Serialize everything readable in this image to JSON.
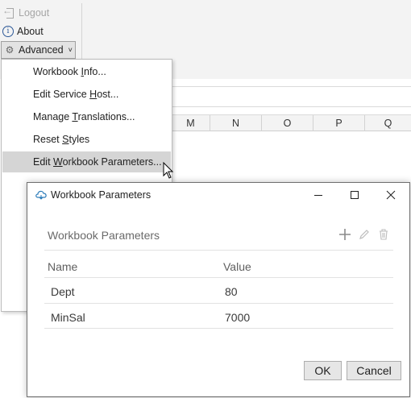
{
  "ribbon": {
    "logout_label": "Logout",
    "about_label": "About",
    "advanced_label": "Advanced",
    "advanced_chevron": "˅"
  },
  "sheet": {
    "columns": [
      "M",
      "N",
      "O",
      "P",
      "Q"
    ]
  },
  "menu": {
    "items": [
      {
        "pre": "Workbook ",
        "u": "I",
        "post": "nfo..."
      },
      {
        "pre": "Edit Service ",
        "u": "H",
        "post": "ost..."
      },
      {
        "pre": "Manage ",
        "u": "T",
        "post": "ranslations..."
      },
      {
        "pre": "Reset ",
        "u": "S",
        "post": "tyles"
      },
      {
        "pre": "Edit ",
        "u": "W",
        "post": "orkbook Parameters..."
      }
    ],
    "highlighted_index": 4
  },
  "dialog": {
    "title": "Workbook Parameters",
    "section_title": "Workbook Parameters",
    "toolbar": {
      "add_icon": "plus-icon",
      "edit_icon": "pencil-icon",
      "delete_icon": "trash-icon"
    },
    "table": {
      "headers": [
        "Name",
        "Value"
      ],
      "rows": [
        [
          "Dept",
          "80"
        ],
        [
          "MinSal",
          "7000"
        ]
      ]
    },
    "ok_label": "OK",
    "cancel_label": "Cancel"
  },
  "colors": {
    "menu_highlight": "#d5d5d5",
    "ribbon_bg": "#f3f3f3",
    "disabled_text": "#a6a6a6",
    "accent_blue": "#2b5797"
  }
}
